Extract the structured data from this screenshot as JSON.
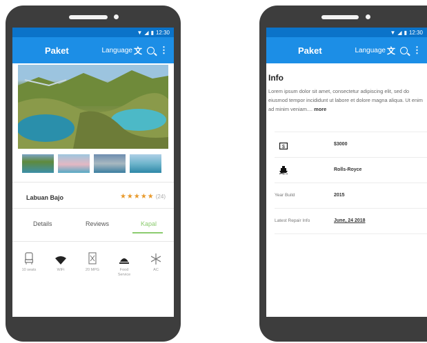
{
  "status": {
    "time": "12:30"
  },
  "appbar": {
    "title": "Paket",
    "language_label": "Language"
  },
  "left": {
    "place_name": "Labuan Bajo",
    "rating_stars": "★★★★★",
    "rating_count": "(24)",
    "tabs": [
      {
        "label": "Details"
      },
      {
        "label": "Reviews"
      },
      {
        "label": "Kapal"
      }
    ],
    "active_tab": "Kapal",
    "amenities": [
      {
        "label": "10 seats",
        "icon": "seat-icon"
      },
      {
        "label": "WiFi",
        "icon": "wifi-icon"
      },
      {
        "label": "20 MPG",
        "icon": "fuel-icon"
      },
      {
        "label": "Food Service",
        "icon": "food-service-icon"
      },
      {
        "label": "AC",
        "icon": "snowflake-icon"
      }
    ]
  },
  "right": {
    "info_title": "Info",
    "info_body": "Lorem ipsum dolor sit amet, consectetur adipiscing elit, sed do eiusmod tempor incididunt ut labore et dolore magna aliqua. Ut enim ad minim veniam....",
    "more_label": "more",
    "rows": [
      {
        "label": "",
        "value": "$3000",
        "icon": "money-icon"
      },
      {
        "label": "",
        "value": "Rolls-Royce",
        "icon": "ship-icon"
      },
      {
        "label": "Year Build",
        "value": "2015"
      },
      {
        "label": "Latest Repair Info",
        "value": "June, 24 2018"
      }
    ]
  },
  "colors": {
    "statusbar": "#0b73c9",
    "appbar": "#1c8ee6",
    "accent": "#8bcb6e",
    "stars": "#e89a2c"
  }
}
